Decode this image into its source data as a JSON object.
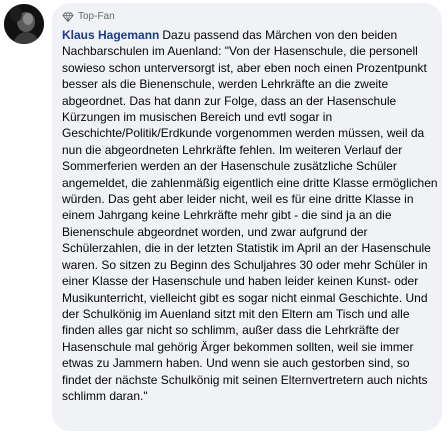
{
  "comment": {
    "badge_label": "Top-Fan",
    "badge_icon": "diamond-icon",
    "author": "Klaus Hagemann",
    "text": "Dazu passend das Märchen von den beiden Nachbarschulen im Auenland: \"Von der Hasenschule, die personell sowieso schon unterversorgt ist, aber eben noch einen Prozentpunkt besser als die Bienenschule, werden Lehrkräfte an die zweite abgeordnet. Das hat dann zur Folge, dass an der Hasenschule Kürzungen im musischen Bereich und evtl sogar in Geschichte/Politik/Erdkunde vorgenommen werden müssen, weil da nun die abgeordneten Lehrkräfte fehlen. Im weiteren Verlauf der Sommerferien werden an der Hasenschule zusätzliche Schüler angemeldet, die zahlenmäßig eigentlich eine dritte Klasse ermöglichen würden. Das geht aber leider nicht, weil es für eine dritte Klasse in einem Jahrgang keine Lehrkräfte mehr gibt - die sind ja an die Bienenschule abgeordnet worden, und zwar aufgrund der Schülerzahlen, die in der letzten Statistik im April an der Hasenschule waren. So sitzen zu Beginn des Schuljahres 30 oder mehr Schüler in einer Klasse der Hasenschule und haben leider keinen Kunst- oder Musikunterricht, vielleicht gibt es sogar nicht einmal Geschichte. Und der Schulkönig im Auenland sitzt mit den Eltern am Tisch und alle finden alles gar nicht so schlimm, außer dass die Lehrkräfte der Hasenschule mal gehörig Ärger bekommen sollten, weil sie immer etwas zu Jammern haben. Und wenn sie auch gestorben sind, so findet der nächste Schulkönig mit seinen Elternvertretern auch nichts schlimm daran.\""
  },
  "colors": {
    "bubble_bg": "#f0f2f5",
    "author_color": "#1a3a8c",
    "text_color": "#050505",
    "badge_color": "#65676b"
  }
}
